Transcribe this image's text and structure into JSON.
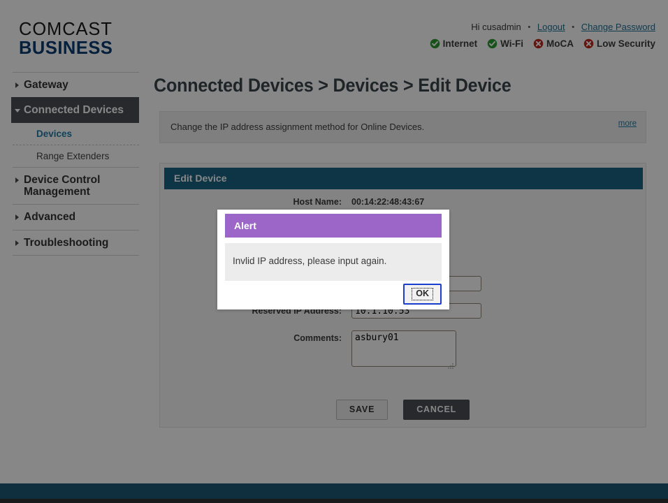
{
  "brand": {
    "line1": "COMCAST",
    "line2": "BUSINESS",
    "color_comcast": "#1a1a1a",
    "color_business": "#0b3d73"
  },
  "header": {
    "greeting": "Hi cusadmin",
    "separator": "•",
    "logout_label": "Logout",
    "change_password_label": "Change Password",
    "status": [
      {
        "label": "Internet",
        "icon": "check-circle-icon",
        "state": "ok",
        "color": "#2e9b34"
      },
      {
        "label": "Wi-Fi",
        "icon": "check-circle-icon",
        "state": "ok",
        "color": "#2e9b34"
      },
      {
        "label": "MoCA",
        "icon": "x-circle-icon",
        "state": "error",
        "color": "#c0281c"
      },
      {
        "label": "Low Security",
        "icon": "x-circle-icon",
        "state": "error",
        "color": "#c0281c"
      }
    ]
  },
  "sidebar": {
    "items": [
      {
        "label": "Gateway",
        "type": "top",
        "expanded": false,
        "icon": "chevron-right-icon"
      },
      {
        "label": "Connected Devices",
        "type": "top",
        "expanded": true,
        "active": true,
        "icon": "chevron-down-icon"
      },
      {
        "label": "Devices",
        "type": "sub",
        "selected": true
      },
      {
        "label": "Range Extenders",
        "type": "sub",
        "selected": false
      },
      {
        "label": "Device Control Management",
        "type": "top",
        "expanded": false,
        "icon": "chevron-right-icon"
      },
      {
        "label": "Advanced",
        "type": "top",
        "expanded": false,
        "icon": "chevron-right-icon"
      },
      {
        "label": "Troubleshooting",
        "type": "top",
        "expanded": false,
        "icon": "chevron-right-icon"
      }
    ]
  },
  "main": {
    "page_title": "Connected Devices > Devices > Edit Device",
    "info": {
      "text": "Change the IP address assignment method for Online Devices.",
      "more_label": "more"
    },
    "panel": {
      "title": "Edit Device",
      "fields": [
        {
          "label": "Host Name:",
          "kind": "static",
          "value": "00:14:22:48:43:67"
        },
        {
          "label": "",
          "kind": "hidden-behind-modal",
          "value": ""
        },
        {
          "label": "",
          "kind": "hidden-behind-modal",
          "value": ""
        },
        {
          "label": "",
          "kind": "text",
          "value": ""
        },
        {
          "label": "Reserved IP Address:",
          "kind": "text",
          "value": "10.1.10.53"
        },
        {
          "label": "Comments:",
          "kind": "textarea",
          "value": "asbury01"
        }
      ],
      "buttons": {
        "save_label": "SAVE",
        "cancel_label": "CANCEL"
      }
    }
  },
  "modal": {
    "title": "Alert",
    "message": "Invlid IP address, please input again.",
    "ok_label": "OK",
    "header_color": "#9c66c8",
    "focused": true
  },
  "footer": {
    "band_color": "#1e5a75",
    "base_color": "#2f3133"
  }
}
